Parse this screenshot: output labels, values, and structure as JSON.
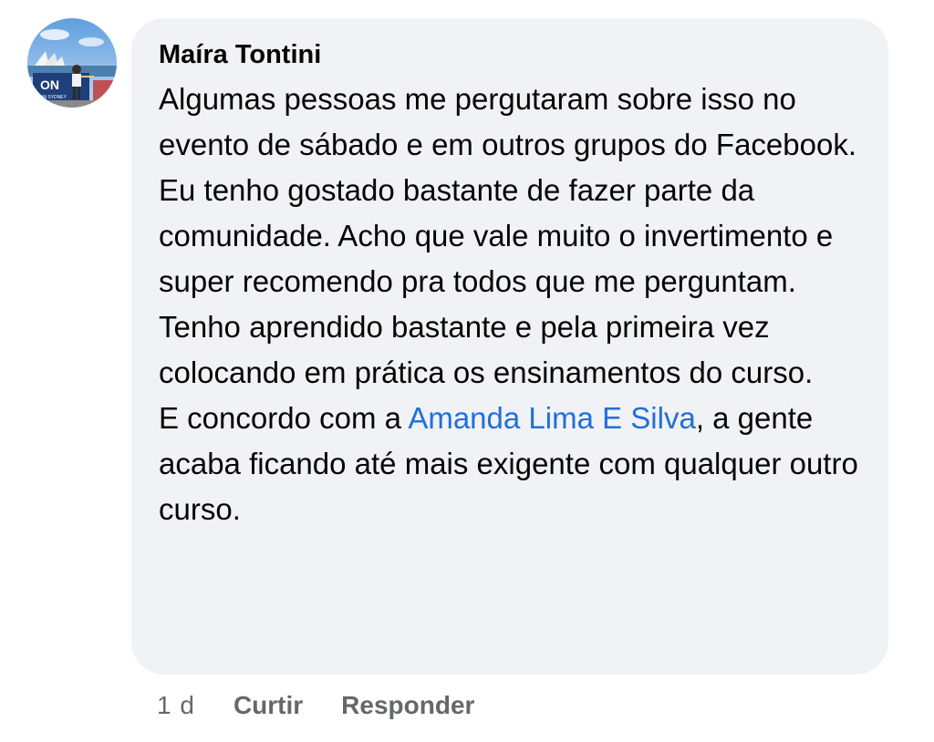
{
  "comment": {
    "author": "Maíra Tontini",
    "avatar_caption": "ON IN SYDNEY",
    "paragraphs": [
      "Algumas pessoas me pergutaram sobre isso no evento de sábado e em outros grupos do Facebook.",
      "Eu tenho gostado bastante de fazer parte da comunidade. Acho que vale muito o invertimento e super recomendo pra todos que me perguntam.",
      "Tenho aprendido bastante e pela primeira vez colocando em prática os ensinamentos do curso."
    ],
    "last_paragraph": {
      "before": "E concordo com a ",
      "mention": "Amanda Lima E Silva",
      "after": ", a gente acaba ficando até mais exigente com qualquer outro curso."
    }
  },
  "actions": {
    "time": "1 d",
    "like": "Curtir",
    "reply": "Responder"
  },
  "colors": {
    "bubble": "#f0f2f5",
    "mention": "#216fdb",
    "meta_text": "#65676b"
  }
}
